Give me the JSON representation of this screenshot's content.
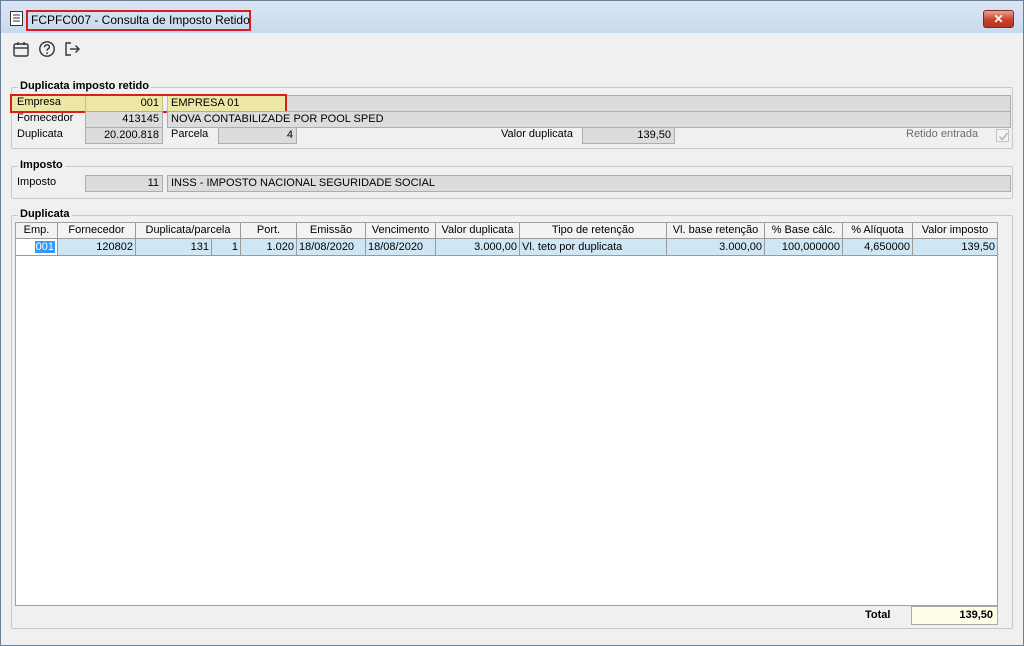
{
  "window": {
    "title": "FCPFC007 - Consulta de Imposto Retido",
    "close_label": "✕"
  },
  "toolbar": {
    "icons": [
      "calendar-icon",
      "help-icon",
      "exit-icon"
    ]
  },
  "duplicata_group": {
    "title": "Duplicata imposto retido",
    "empresa_label": "Empresa",
    "empresa_code": "001",
    "empresa_name": "EMPRESA 01",
    "fornecedor_label": "Fornecedor",
    "fornecedor_code": "413145",
    "fornecedor_name": "NOVA CONTABILIZADE POR POOL SPED",
    "duplicata_label": "Duplicata",
    "duplicata_value": "20.200.818",
    "parcela_label": "Parcela",
    "parcela_value": "4",
    "valor_label": "Valor duplicata",
    "valor_value": "139,50",
    "retido_label": "Retido entrada",
    "retido_checked": true
  },
  "imposto_group": {
    "title": "Imposto",
    "imposto_label": "Imposto",
    "imposto_code": "11",
    "imposto_name": "INSS - IMPOSTO NACIONAL SEGURIDADE SOCIAL"
  },
  "grid": {
    "title": "Duplicata",
    "headers": [
      "Emp.",
      "Fornecedor",
      "Duplicata/parcela",
      "Port.",
      "Emissão",
      "Vencimento",
      "Valor duplicata",
      "Tipo de retenção",
      "Vl. base retenção",
      "% Base cálc.",
      "% Alíquota",
      "Valor imposto"
    ],
    "row": {
      "emp": "001",
      "fornecedor": "120802",
      "duplicata": "131",
      "parcela": "1",
      "port": "1.020",
      "emissao": "18/08/2020",
      "vencimento": "18/08/2020",
      "valor_duplicata": "3.000,00",
      "tipo_retencao": "Vl. teto por duplicata",
      "vl_base": "3.000,00",
      "base_calc": "100,000000",
      "aliquota": "4,650000",
      "valor_imposto": "139,50"
    },
    "total_label": "Total",
    "total_value": "139,50"
  }
}
